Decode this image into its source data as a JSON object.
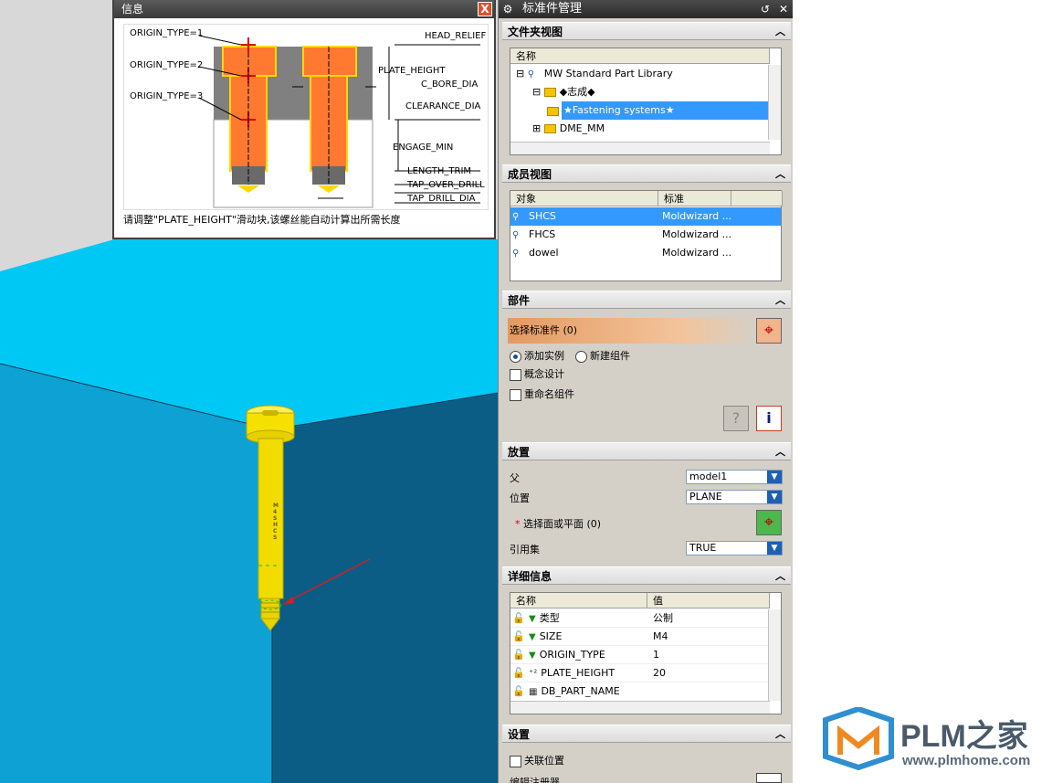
{
  "info_window": {
    "title": "信息",
    "close": "X",
    "labels": {
      "origin1": "ORIGIN_TYPE=1",
      "origin2": "ORIGIN_TYPE=2",
      "origin3": "ORIGIN_TYPE=3",
      "head_relief": "HEAD_RELIEF",
      "plate_height": "PLATE_HEIGHT",
      "c_bore_dia": "C_BORE_DIA",
      "clearance_dia": "CLEARANCE_DIA",
      "engage_min": "ENGAGE_MIN",
      "length_trim": "LENGTH_TRIM",
      "tap_over_drill": "TAP_OVER_DRILL",
      "tap_drill_dia": "TAP_DRILL_DIA"
    },
    "message": "请调整\"PLATE_HEIGHT\"滑动块,该螺丝能自动计算出所需长度"
  },
  "panel": {
    "title": "标准件管理",
    "folder_view": {
      "header": "文件夹视图",
      "col_name": "名称",
      "items": [
        {
          "label": "MW Standard Part Library",
          "expander": "⊟"
        },
        {
          "label": "◆志成◆",
          "expander": "⊟"
        },
        {
          "label": "★Fastening systems★",
          "expander": ""
        },
        {
          "label": "DME_MM",
          "expander": "⊞"
        }
      ]
    },
    "member_view": {
      "header": "成员视图",
      "col_object": "对象",
      "col_standard": "标准",
      "rows": [
        {
          "object": "SHCS",
          "standard": "Moldwizard ..."
        },
        {
          "object": "FHCS",
          "standard": "Moldwizard ..."
        },
        {
          "object": "dowel",
          "standard": "Moldwizard ..."
        }
      ]
    },
    "part": {
      "header": "部件",
      "select_label": "选择标准件 (0)",
      "radio_add": "添加实例",
      "radio_new": "新建组件",
      "concept": "概念设计",
      "rename": "重命名组件"
    },
    "placement": {
      "header": "放置",
      "parent_label": "父",
      "parent_value": "model1",
      "position_label": "位置",
      "position_value": "PLANE",
      "select_face": "选择面或平面 (0)",
      "refset_label": "引用集",
      "refset_value": "TRUE"
    },
    "details": {
      "header": "详细信息",
      "col_name": "名称",
      "col_value": "值",
      "rows": [
        {
          "name": "类型",
          "value": "公制"
        },
        {
          "name": "SIZE",
          "value": "M4"
        },
        {
          "name": "ORIGIN_TYPE",
          "value": "1"
        },
        {
          "name": "PLATE_HEIGHT",
          "value": "20"
        },
        {
          "name": "DB_PART_NAME",
          "value": ""
        }
      ]
    },
    "settings": {
      "header": "设置",
      "assoc": "关联位置",
      "partial": "编辑注册器"
    }
  },
  "bolt_mark": "M4 SHCS",
  "watermark": {
    "text": "PLM之家",
    "url": "www.plmhome.com"
  }
}
